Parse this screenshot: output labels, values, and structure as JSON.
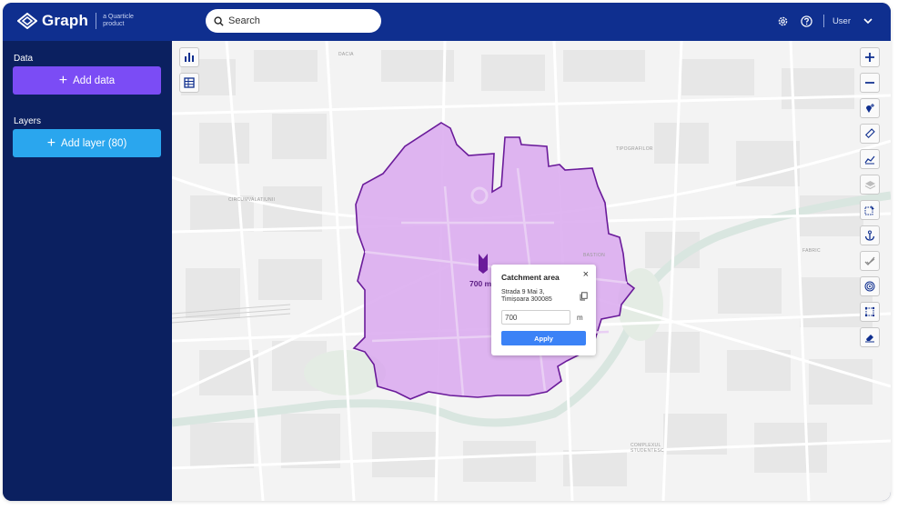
{
  "header": {
    "brand": "Graph",
    "tagline": "a Quarticle product",
    "search_placeholder": "Search",
    "user_label": "User"
  },
  "sidebar": {
    "data_title": "Data",
    "add_data_label": "Add data",
    "layers_title": "Layers",
    "add_layer_label": "Add layer (80)"
  },
  "map": {
    "pin_label": "700 m",
    "labels": [
      "DACIA",
      "CIRCUMVALATIUNII",
      "TIPOGRAFILOR",
      "BASTION",
      "FABRIC",
      "COMPLEXUL STUDENTESC"
    ],
    "catchment_color": "#d9a8ee",
    "catchment_border": "#6a1b9a",
    "controls": [
      "chart-icon",
      "table-icon",
      "zoom-in-icon",
      "zoom-out-icon",
      "add-pin-icon",
      "ruler-icon",
      "line-chart-icon",
      "layers-icon",
      "select-area-icon",
      "anchor-icon",
      "check-icon",
      "target-icon",
      "polygon-icon",
      "eraser-icon"
    ]
  },
  "popup": {
    "title": "Catchment area",
    "close": "×",
    "address_line1": "Strada 9 Mai 3,",
    "address_line2": "Timișoara 300085",
    "radius_value": "700",
    "unit": "m",
    "apply_label": "Apply"
  },
  "colors": {
    "topbar": "#0f2f8f",
    "sidebar": "#0b2060",
    "add_data": "#7b4cf5",
    "add_layer": "#2aa6ee",
    "apply": "#3b82f6"
  }
}
